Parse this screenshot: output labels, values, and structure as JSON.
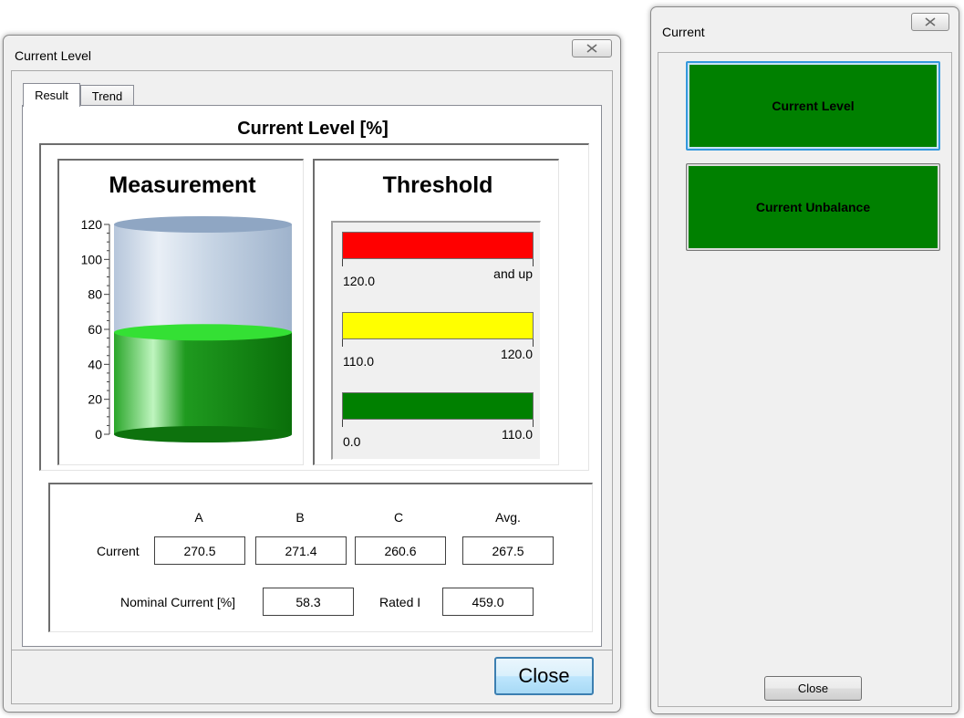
{
  "level_window": {
    "title": "Current Level",
    "tabs": [
      {
        "label": "Result"
      },
      {
        "label": "Trend"
      }
    ],
    "panel_title": "Current Level [%]",
    "measurement": {
      "title": "Measurement",
      "axis_ticks": [
        "120",
        "100",
        "80",
        "60",
        "40",
        "20",
        "0"
      ],
      "axis_max": 120,
      "fill_value": 58.3,
      "fill_color": "#008000"
    },
    "threshold": {
      "title": "Threshold",
      "bands": [
        {
          "color": "#ff0000",
          "low": "120.0",
          "high": "and up"
        },
        {
          "color": "#ffff00",
          "low": "110.0",
          "high": "120.0"
        },
        {
          "color": "#008000",
          "low": "0.0",
          "high": "110.0"
        }
      ]
    },
    "readings": {
      "columns": [
        "A",
        "B",
        "C",
        "Avg."
      ],
      "row_label": "Current",
      "values": [
        "270.5",
        "271.4",
        "260.6",
        "267.5"
      ],
      "nominal_label": "Nominal Current [%]",
      "nominal_value": "58.3",
      "rated_label": "Rated I",
      "rated_value": "459.0"
    },
    "close_label": "Close"
  },
  "current_window": {
    "title": "Current",
    "buttons": [
      {
        "label": "Current Level"
      },
      {
        "label": "Current Unbalance"
      }
    ],
    "close_label": "Close"
  }
}
